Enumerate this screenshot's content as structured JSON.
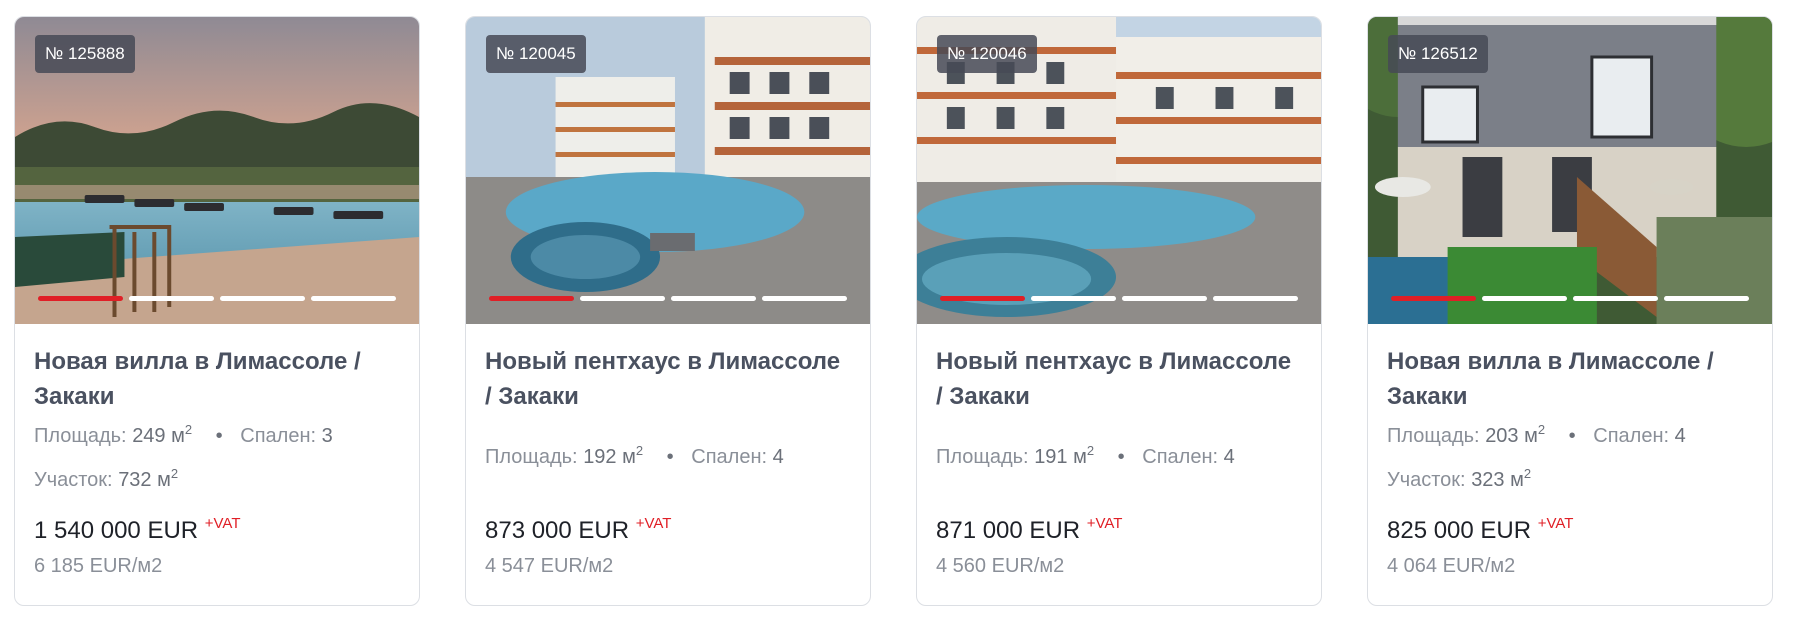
{
  "colors": {
    "accent": "#e01f26",
    "title": "#4a5160",
    "muted": "#8a8f98",
    "price": "#1e2128"
  },
  "cards": [
    {
      "id_label": "№ 125888",
      "image_alt": "pool-villa-sunset",
      "title": "Новая вилла в Лимассоле / Закаки",
      "area_label": "Площадь:",
      "area_value": "249 м",
      "area_sup": "2",
      "bedrooms_label": "Спален:",
      "bedrooms_value": "3",
      "plot_label": "Участок:",
      "plot_value": "732 м",
      "plot_sup": "2",
      "price": "1 540 000  EUR",
      "vat": "+VAT",
      "price_per_m2": "6 185  EUR/м2",
      "slider_total": 4,
      "slider_active": 1
    },
    {
      "id_label": "№ 120045",
      "image_alt": "apartment-pool",
      "title": "Новый пентхаус в Лимассоле / Закаки",
      "area_label": "Площадь:",
      "area_value": "192 м",
      "area_sup": "2",
      "bedrooms_label": "Спален:",
      "bedrooms_value": "4",
      "price": "873 000  EUR",
      "vat": "+VAT",
      "price_per_m2": "4 547  EUR/м2",
      "slider_total": 4,
      "slider_active": 1
    },
    {
      "id_label": "№ 120046",
      "image_alt": "apartment-pool-2",
      "title": "Новый пентхаус в Лимассоле / Закаки",
      "area_label": "Площадь:",
      "area_value": "191 м",
      "area_sup": "2",
      "bedrooms_label": "Спален:",
      "bedrooms_value": "4",
      "price": "871 000  EUR",
      "vat": "+VAT",
      "price_per_m2": "4 560  EUR/м2",
      "slider_total": 4,
      "slider_active": 1
    },
    {
      "id_label": "№ 126512",
      "image_alt": "modern-villa-garden",
      "title": "Новая вилла в Лимассоле / Закаки",
      "area_label": "Площадь:",
      "area_value": "203 м",
      "area_sup": "2",
      "bedrooms_label": "Спален:",
      "bedrooms_value": "4",
      "plot_label": "Участок:",
      "plot_value": "323 м",
      "plot_sup": "2",
      "price": "825 000  EUR",
      "vat": "+VAT",
      "price_per_m2": "4 064  EUR/м2",
      "slider_total": 4,
      "slider_active": 1
    }
  ]
}
